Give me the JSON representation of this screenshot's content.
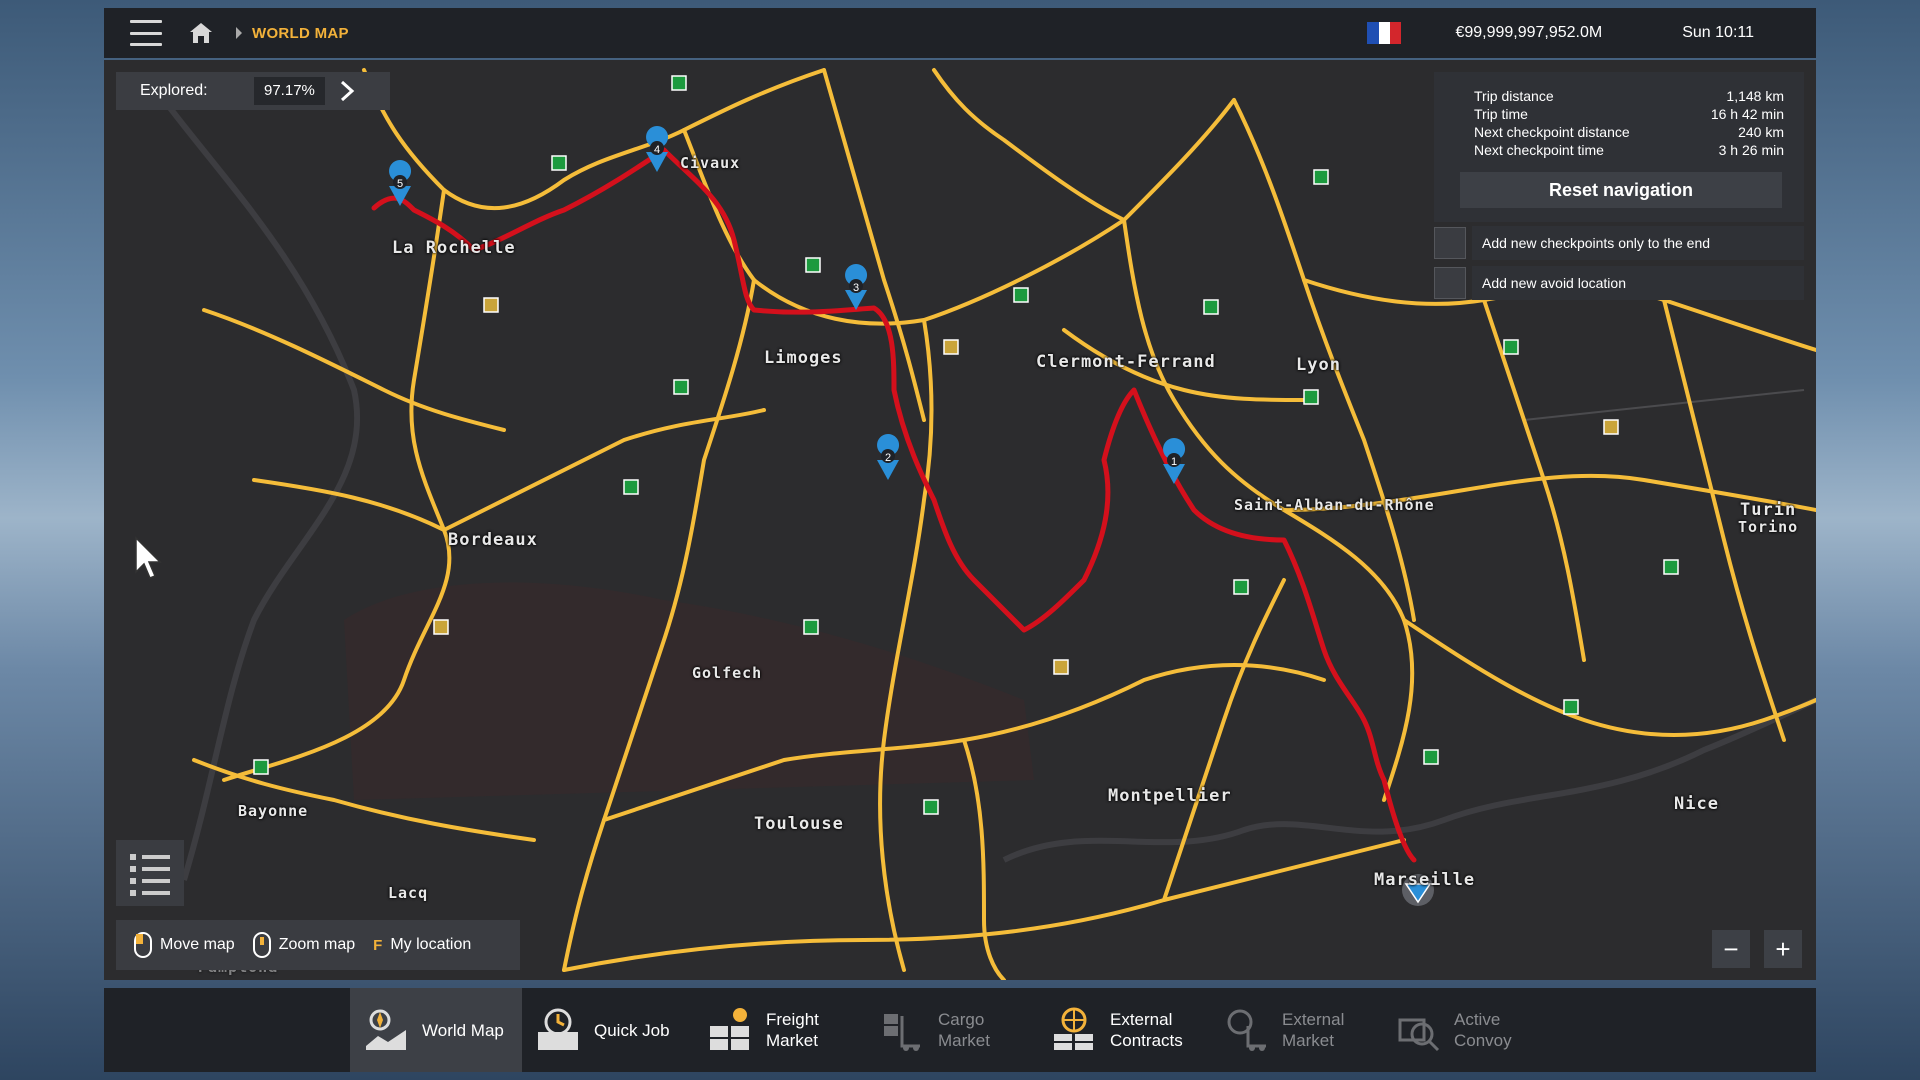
{
  "header": {
    "breadcrumb": "WORLD MAP",
    "money": "€99,999,997,952.0M",
    "time": "Sun 10:11",
    "flag_colors": [
      "#1f4fb3",
      "#ffffff",
      "#d3262c"
    ]
  },
  "explored": {
    "label": "Explored:",
    "value": "97.17%"
  },
  "navigation": {
    "rows": [
      {
        "label": "Trip distance",
        "value": "1,148 km"
      },
      {
        "label": "Trip time",
        "value": "16 h 42 min"
      },
      {
        "label": "Next checkpoint distance",
        "value": "240 km"
      },
      {
        "label": "Next checkpoint time",
        "value": "3 h 26 min"
      }
    ],
    "reset_label": "Reset navigation",
    "option_end": "Add new checkpoints only to the end",
    "option_avoid": "Add new avoid location"
  },
  "cities": {
    "la_rochelle": "La Rochelle",
    "civaux": "Civaux",
    "limoges": "Limoges",
    "clermont": "Clermont-Ferrand",
    "lyon": "Lyon",
    "saint_alban": "Saint-Alban-du-Rhône",
    "turin": "Turin",
    "torino": "Torino",
    "bordeaux": "Bordeaux",
    "golfech": "Golfech",
    "bayonne": "Bayonne",
    "toulouse": "Toulouse",
    "montpellier": "Montpellier",
    "marseille": "Marseille",
    "nice": "Nice",
    "lacq": "Lacq",
    "pamplona": "Pamplona"
  },
  "checkpoints": [
    "1",
    "2",
    "3",
    "4",
    "5"
  ],
  "hints": {
    "move": "Move map",
    "zoom": "Zoom map",
    "location_key": "F",
    "location": "My location"
  },
  "zoom": {
    "minus": "−",
    "plus": "+"
  },
  "tabs": [
    {
      "line1": "World Map",
      "line2": ""
    },
    {
      "line1": "Quick Job",
      "line2": ""
    },
    {
      "line1": "Freight",
      "line2": "Market"
    },
    {
      "line1": "Cargo",
      "line2": "Market"
    },
    {
      "line1": "External",
      "line2": "Contracts"
    },
    {
      "line1": "External",
      "line2": "Market"
    },
    {
      "line1": "Active",
      "line2": "Convoy"
    }
  ],
  "colors": {
    "road": "#f5bd3a",
    "route": "#d4101c",
    "accent": "#f3b23a",
    "pin": "#2a8fd8"
  }
}
